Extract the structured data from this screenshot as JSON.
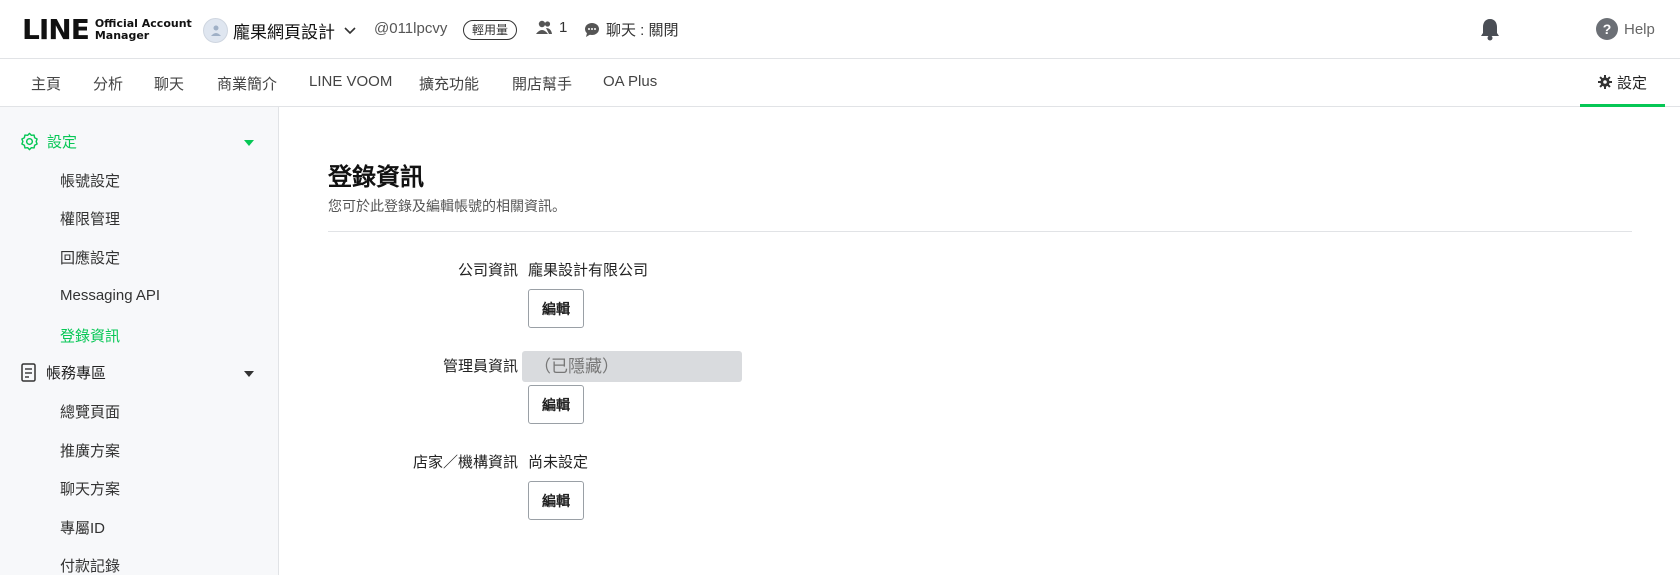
{
  "header": {
    "logo_main": "LINE",
    "logo_sub_1": "Official Account",
    "logo_sub_2": "Manager",
    "account_name": "龐果網頁設計",
    "account_id": "@011lpcvy",
    "usage_badge": "輕用量",
    "friend_count": "1",
    "chat_status": "聊天 : 關閉",
    "help_label": "Help"
  },
  "nav": {
    "items": [
      "主頁",
      "分析",
      "聊天",
      "商業簡介",
      "LINE VOOM",
      "擴充功能",
      "開店幫手",
      "OA Plus"
    ],
    "settings_label": "設定"
  },
  "sidebar": {
    "group1": {
      "label": "設定",
      "items": [
        "帳號設定",
        "權限管理",
        "回應設定",
        "Messaging API",
        "登錄資訊"
      ]
    },
    "group2": {
      "label": "帳務專區",
      "items": [
        "總覽頁面",
        "推廣方案",
        "聊天方案",
        "專屬ID",
        "付款記錄"
      ]
    }
  },
  "main": {
    "title": "登錄資訊",
    "description": "您可於此登錄及編輯帳號的相關資訊。",
    "rows": [
      {
        "label": "公司資訊",
        "value": "龐果設計有限公司",
        "button": "編輯"
      },
      {
        "label": "管理員資訊",
        "value": "（已隱藏）",
        "button": "編輯"
      },
      {
        "label": "店家／機構資訊",
        "value": "尚未設定",
        "button": "編輯"
      }
    ]
  },
  "colors": {
    "accent": "#06c755",
    "sidebar_bg": "#f7f8fa",
    "hidden_bg": "#d9dbde"
  },
  "icons": [
    "user-avatar-icon",
    "chevron-down-icon",
    "friends-icon",
    "chat-bubble-icon",
    "bell-icon",
    "help-icon",
    "gear-icon",
    "billing-icon",
    "caret-down-icon"
  ]
}
